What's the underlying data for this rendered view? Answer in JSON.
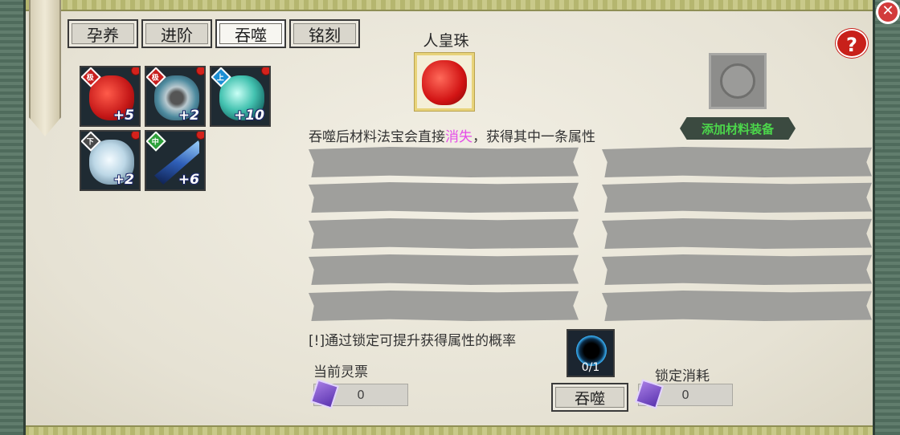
{
  "tabs": [
    {
      "label": "孕养",
      "active": false
    },
    {
      "label": "进阶",
      "active": false
    },
    {
      "label": "吞噬",
      "active": true
    },
    {
      "label": "铭刻",
      "active": false
    }
  ],
  "inventory": [
    {
      "grade": "极",
      "level": "+5",
      "color": "#d7241f",
      "tag_color": "#c81f1f",
      "icon": "red-crystal-icon"
    },
    {
      "grade": "极",
      "level": "+2",
      "color": "#5a8ea0",
      "tag_color": "#c81f1f",
      "icon": "teal-mirror-icon"
    },
    {
      "grade": "上",
      "level": "+10",
      "color": "#3fb8a7",
      "tag_color": "#1b8ed4",
      "icon": "jade-orb-icon"
    },
    {
      "grade": "下",
      "level": "+2",
      "color": "#bcd7e6",
      "tag_color": "#4a4a4a",
      "icon": "silver-mirror-icon"
    },
    {
      "grade": "中",
      "level": "+6",
      "color": "#2f5fb8",
      "tag_color": "#2ea13b",
      "icon": "blue-flag-icon"
    }
  ],
  "target": {
    "name": "人皇珠",
    "icon": "red-pearl-icon"
  },
  "help_icon": "question-icon",
  "close_icon": "close-icon",
  "material": {
    "icon": "yin-yang-icon",
    "add_label": "添加材料装备"
  },
  "description": {
    "before": "吞噬后材料法宝会直接",
    "highlight": "消失",
    "after": "，获得其中一条属性"
  },
  "hint": "[!]通过锁定可提升获得属性的概率",
  "current_ticket": {
    "label": "当前灵票",
    "value": "0"
  },
  "lock_cost": {
    "label": "锁定消耗",
    "value": "0"
  },
  "devour_slot": {
    "count": "0/1",
    "icon": "black-hole-icon"
  },
  "devour_button": "吞噬",
  "colors": {
    "highlight": "#e54ce8",
    "add_material_text": "#4cd64b",
    "property_bar": "#9f9f9c"
  }
}
